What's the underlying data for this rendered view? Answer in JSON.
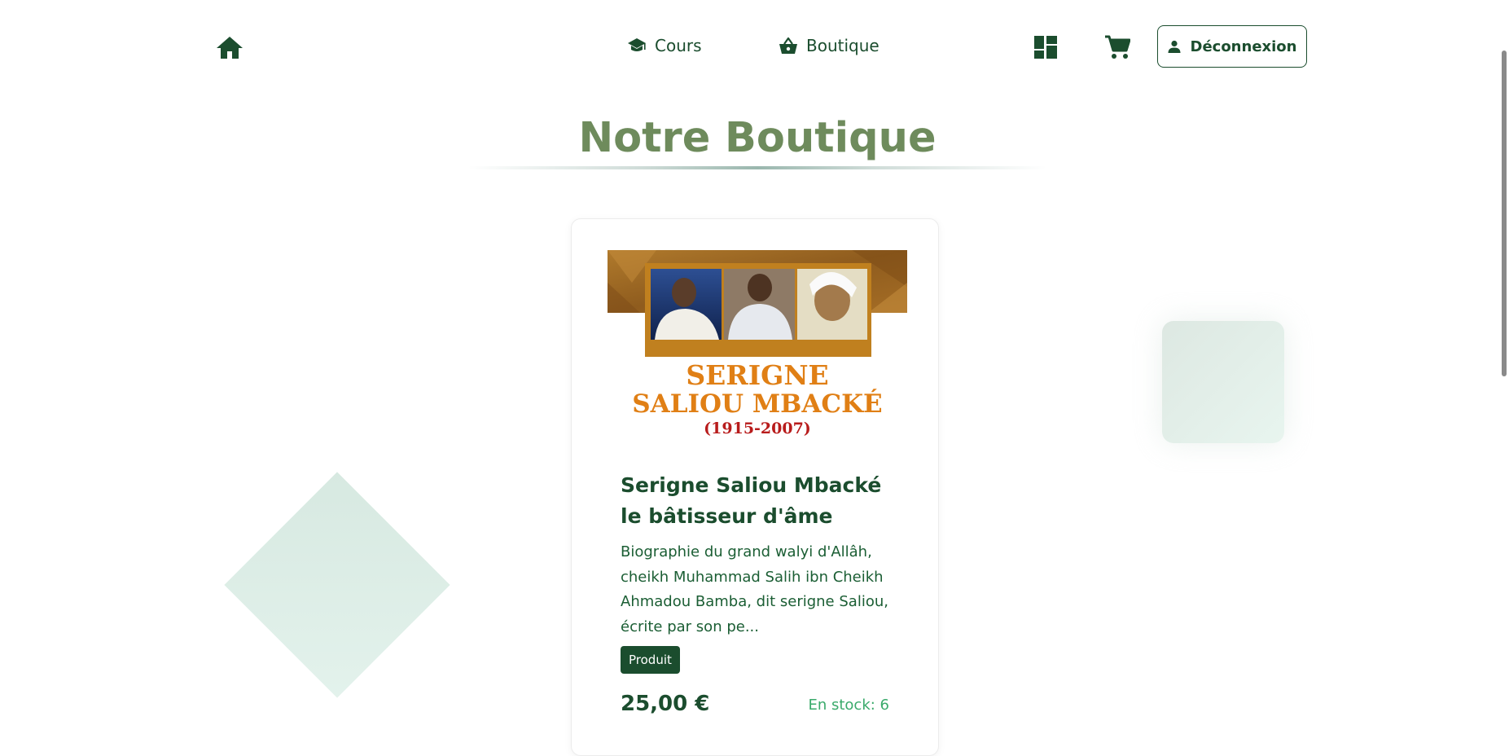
{
  "nav": {
    "home_icon": "home-icon",
    "links": [
      {
        "label": "Cours",
        "icon": "graduation-cap-icon"
      },
      {
        "label": "Boutique",
        "icon": "shopping-basket-icon"
      }
    ],
    "dashboard_icon": "dashboard-icon",
    "cart_icon": "shopping-cart-icon",
    "logout": {
      "label": "Déconnexion",
      "icon": "person-icon"
    }
  },
  "page": {
    "title": "Notre Boutique"
  },
  "products": [
    {
      "cover": {
        "line1": "SERIGNE",
        "line2": "SALIOU MBACKÉ",
        "years": "(1915-2007)"
      },
      "title": "Serigne Saliou Mbacké le bâtisseur d'âme",
      "description": "Biographie du grand walyi d'Allâh, cheikh Muhammad Salih ibn Cheikh Ahmadou Bamba, dit serigne Saliou, écrite par son pe...",
      "badge": "Produit",
      "price": "25,00 €",
      "stock": "En stock: 6"
    }
  ],
  "colors": {
    "primary": "#1b4d2e",
    "title": "#6e8b5c",
    "stock": "#3aaa6b",
    "cover_orange": "#e07f15",
    "cover_red": "#b81c1c"
  }
}
